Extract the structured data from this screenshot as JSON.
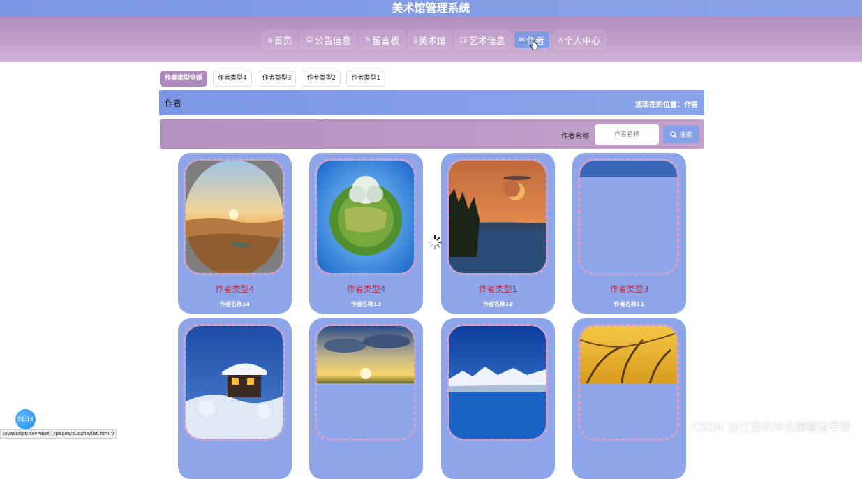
{
  "app": {
    "title": "美术馆管理系统"
  },
  "nav": {
    "items": [
      {
        "icon": "⌂",
        "label": "首页"
      },
      {
        "icon": "☺",
        "label": "公告信息"
      },
      {
        "icon": "✎",
        "label": "留言板"
      },
      {
        "icon": "▯",
        "label": "美术馆"
      },
      {
        "icon": "▯▯",
        "label": "艺术信息"
      },
      {
        "icon": "✉",
        "label": "作者"
      },
      {
        "icon": "ᴧ",
        "label": "个人中心"
      }
    ],
    "active": "作者"
  },
  "filters": {
    "chips": [
      "作者类型全部",
      "作者类型4",
      "作者类型3",
      "作者类型2",
      "作者类型1"
    ],
    "active": "作者类型全部"
  },
  "page": {
    "title": "作者",
    "location": "您现在的位置：作者"
  },
  "search": {
    "label": "作者名称",
    "placeholder": "作者名称",
    "button": "搜索"
  },
  "cards": [
    {
      "type": "作者类型4",
      "name": "作者名称14",
      "image": "desert-sunset-oasis"
    },
    {
      "type": "作者类型4",
      "name": "作者名称13",
      "image": "tiny-planet-tree"
    },
    {
      "type": "作者类型1",
      "name": "作者名称12",
      "image": "moon-lake-forest"
    },
    {
      "type": "作者类型3",
      "name": "作者名称11",
      "image": "blue-sky"
    },
    {
      "type": "",
      "name": "",
      "image": "snow-cabin-night"
    },
    {
      "type": "",
      "name": "",
      "image": "sun-through-clouds"
    },
    {
      "type": "",
      "name": "",
      "image": "snow-mountain-lake"
    },
    {
      "type": "",
      "name": "",
      "image": "golden-autumn-trees"
    }
  ],
  "overlay": {
    "timer": "01:14",
    "status_url": "javascript:navPage('./pages/zuozhe/list.html')",
    "watermark": "CSDN @计算机毕业编程指导师"
  },
  "colors": {
    "accent_blue": "#7b96e4",
    "accent_purple": "#b08dbd",
    "card_bg": "#8fa5ea",
    "card_title": "#b0304c",
    "dashed_border": "#d7a3c8"
  }
}
